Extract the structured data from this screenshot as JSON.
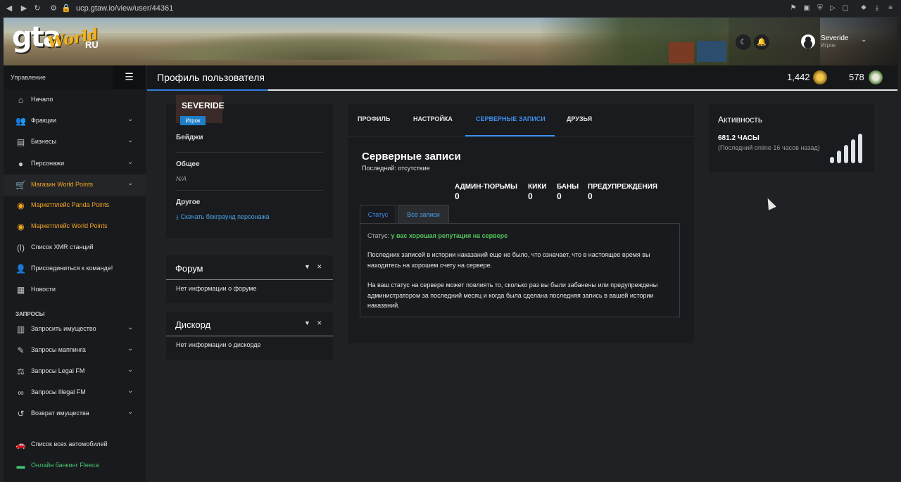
{
  "browser": {
    "url": "ucp.gtaw.io/view/user/44361"
  },
  "brand": {
    "logo_main": "gta",
    "logo_world": "World",
    "logo_region": "RU"
  },
  "user_menu": {
    "name": "Severide",
    "role": "Игрок"
  },
  "sidebar": {
    "section_label": "Управление",
    "items": [
      {
        "label": "Начало",
        "icon": "home-icon"
      },
      {
        "label": "Фракции",
        "icon": "users-icon"
      },
      {
        "label": "Бизнесы",
        "icon": "briefcase-icon"
      },
      {
        "label": "Персонажи",
        "icon": "user-icon"
      },
      {
        "label": "Магазин World Points",
        "icon": "cart-icon"
      },
      {
        "label": "Маркетплейс Panda Points",
        "icon": "coins-icon"
      },
      {
        "label": "Маркетплейс World Points",
        "icon": "coins-icon"
      },
      {
        "label": "Список XMR станций",
        "icon": "antenna-icon"
      },
      {
        "label": "Присоединиться к команде!",
        "icon": "user-plus-icon"
      },
      {
        "label": "Новости",
        "icon": "newspaper-icon"
      }
    ],
    "requests_label": "ЗАПРОСЫ",
    "request_items": [
      {
        "label": "Запросить имущество",
        "icon": "building-icon"
      },
      {
        "label": "Запросы маппинга",
        "icon": "brush-icon"
      },
      {
        "label": "Запросы Legal FM",
        "icon": "scale-icon"
      },
      {
        "label": "Запросы Illegal FM",
        "icon": "mask-icon"
      },
      {
        "label": "Возврат имущества",
        "icon": "undo-icon"
      }
    ],
    "bottom_items": [
      {
        "label": "Список всех автомобилей",
        "icon": "car-icon"
      },
      {
        "label": "Онлайн банкинг Fleeca",
        "icon": "bank-card-icon"
      }
    ]
  },
  "header": {
    "title": "Профиль пользователя",
    "world_points": "1,442",
    "panda_points": "578"
  },
  "profile": {
    "name": "SEVERIDE",
    "badge": "Игрок",
    "badges_label": "Бейджи",
    "general_label": "Общее",
    "general_value": "N/A",
    "other_label": "Другое",
    "download_link": "Скачать бекграунд персонажа"
  },
  "forum": {
    "title": "Форум",
    "body": "Нет информации о форуме"
  },
  "discord": {
    "title": "Дискорд",
    "body": "Нет информации о дискорде"
  },
  "tabs": [
    "ПРОФИЛЬ",
    "НАСТРОЙКА",
    "СЕРВЕРНЫЕ ЗАПИСИ",
    "ДРУЗЬЯ"
  ],
  "records": {
    "title": "Серверные записи",
    "last": "Последний: отсутствие",
    "counters": [
      {
        "label": "АДМИН-ТЮРЬМЫ",
        "value": "0"
      },
      {
        "label": "КИКИ",
        "value": "0"
      },
      {
        "label": "БАНЫ",
        "value": "0"
      },
      {
        "label": "ПРЕДУПРЕЖДЕНИЯ",
        "value": "0"
      }
    ],
    "subtabs": [
      "Статус",
      "Все записи"
    ],
    "status_prefix": "Статус:",
    "status_value": "у вас хорошая репутация на сервере",
    "para1": "Последних записей в истории наказаний еще не было, что означает, что в настоящее время вы находитесь на хорошем счету на сервере.",
    "para2": "На ваш статус на сервере может повлиять то, сколько раз вы были забанены или предупреждены администратором за последний месяц и когда была сделана последняя запись в вашей истории наказаний."
  },
  "activity": {
    "title": "Активность",
    "hours": "681.2 ЧАСЫ",
    "last_online": "(Последний online 16 часов назад)"
  },
  "colors": {
    "accent": "#3d8ff0",
    "good": "#55c35a",
    "orange": "#f5a623",
    "green": "#46c06e"
  }
}
